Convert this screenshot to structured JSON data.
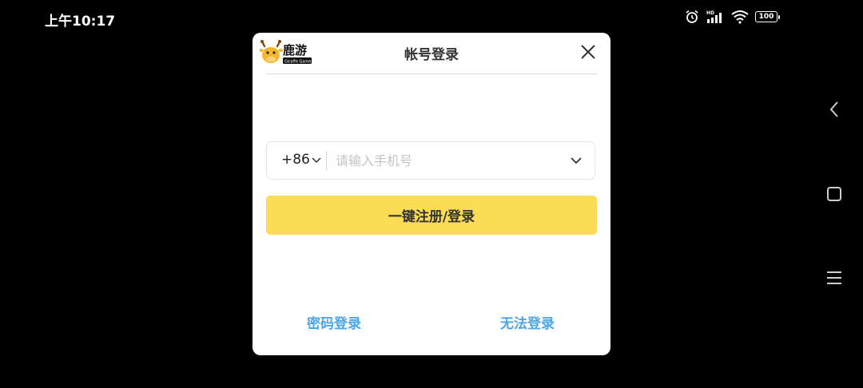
{
  "status_bar": {
    "time": "上午10:17",
    "network_badge": "HD",
    "battery": "100"
  },
  "dialog": {
    "logo_text": "鹿游",
    "logo_subtext": "Giraffe Game",
    "title": "帐号登录",
    "country_code": "+86",
    "phone_placeholder": "请输入手机号",
    "phone_value": "",
    "login_button": "一键注册/登录",
    "password_login_link": "密码登录",
    "cannot_login_link": "无法登录"
  },
  "colors": {
    "accent_yellow": "#fddc55",
    "link_blue": "#4aa6e6"
  },
  "icons": [
    "alarm-icon",
    "signal-icon",
    "wifi-icon",
    "battery-icon",
    "back-icon",
    "home-icon",
    "menu-icon",
    "close-icon",
    "chevron-down-icon"
  ]
}
